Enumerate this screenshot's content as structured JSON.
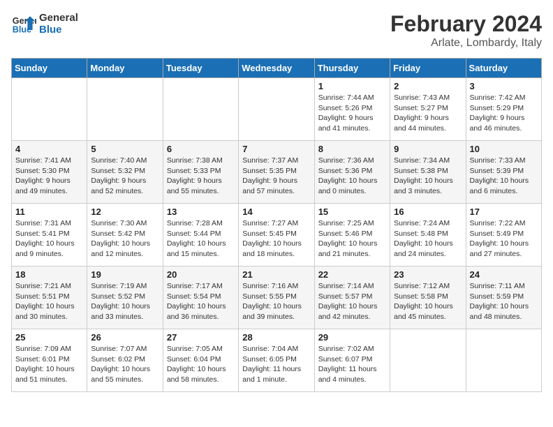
{
  "header": {
    "logo_line1": "General",
    "logo_line2": "Blue",
    "main_title": "February 2024",
    "subtitle": "Arlate, Lombardy, Italy"
  },
  "weekdays": [
    "Sunday",
    "Monday",
    "Tuesday",
    "Wednesday",
    "Thursday",
    "Friday",
    "Saturday"
  ],
  "weeks": [
    [
      {
        "day": "",
        "info": ""
      },
      {
        "day": "",
        "info": ""
      },
      {
        "day": "",
        "info": ""
      },
      {
        "day": "",
        "info": ""
      },
      {
        "day": "1",
        "info": "Sunrise: 7:44 AM\nSunset: 5:26 PM\nDaylight: 9 hours\nand 41 minutes."
      },
      {
        "day": "2",
        "info": "Sunrise: 7:43 AM\nSunset: 5:27 PM\nDaylight: 9 hours\nand 44 minutes."
      },
      {
        "day": "3",
        "info": "Sunrise: 7:42 AM\nSunset: 5:29 PM\nDaylight: 9 hours\nand 46 minutes."
      }
    ],
    [
      {
        "day": "4",
        "info": "Sunrise: 7:41 AM\nSunset: 5:30 PM\nDaylight: 9 hours\nand 49 minutes."
      },
      {
        "day": "5",
        "info": "Sunrise: 7:40 AM\nSunset: 5:32 PM\nDaylight: 9 hours\nand 52 minutes."
      },
      {
        "day": "6",
        "info": "Sunrise: 7:38 AM\nSunset: 5:33 PM\nDaylight: 9 hours\nand 55 minutes."
      },
      {
        "day": "7",
        "info": "Sunrise: 7:37 AM\nSunset: 5:35 PM\nDaylight: 9 hours\nand 57 minutes."
      },
      {
        "day": "8",
        "info": "Sunrise: 7:36 AM\nSunset: 5:36 PM\nDaylight: 10 hours\nand 0 minutes."
      },
      {
        "day": "9",
        "info": "Sunrise: 7:34 AM\nSunset: 5:38 PM\nDaylight: 10 hours\nand 3 minutes."
      },
      {
        "day": "10",
        "info": "Sunrise: 7:33 AM\nSunset: 5:39 PM\nDaylight: 10 hours\nand 6 minutes."
      }
    ],
    [
      {
        "day": "11",
        "info": "Sunrise: 7:31 AM\nSunset: 5:41 PM\nDaylight: 10 hours\nand 9 minutes."
      },
      {
        "day": "12",
        "info": "Sunrise: 7:30 AM\nSunset: 5:42 PM\nDaylight: 10 hours\nand 12 minutes."
      },
      {
        "day": "13",
        "info": "Sunrise: 7:28 AM\nSunset: 5:44 PM\nDaylight: 10 hours\nand 15 minutes."
      },
      {
        "day": "14",
        "info": "Sunrise: 7:27 AM\nSunset: 5:45 PM\nDaylight: 10 hours\nand 18 minutes."
      },
      {
        "day": "15",
        "info": "Sunrise: 7:25 AM\nSunset: 5:46 PM\nDaylight: 10 hours\nand 21 minutes."
      },
      {
        "day": "16",
        "info": "Sunrise: 7:24 AM\nSunset: 5:48 PM\nDaylight: 10 hours\nand 24 minutes."
      },
      {
        "day": "17",
        "info": "Sunrise: 7:22 AM\nSunset: 5:49 PM\nDaylight: 10 hours\nand 27 minutes."
      }
    ],
    [
      {
        "day": "18",
        "info": "Sunrise: 7:21 AM\nSunset: 5:51 PM\nDaylight: 10 hours\nand 30 minutes."
      },
      {
        "day": "19",
        "info": "Sunrise: 7:19 AM\nSunset: 5:52 PM\nDaylight: 10 hours\nand 33 minutes."
      },
      {
        "day": "20",
        "info": "Sunrise: 7:17 AM\nSunset: 5:54 PM\nDaylight: 10 hours\nand 36 minutes."
      },
      {
        "day": "21",
        "info": "Sunrise: 7:16 AM\nSunset: 5:55 PM\nDaylight: 10 hours\nand 39 minutes."
      },
      {
        "day": "22",
        "info": "Sunrise: 7:14 AM\nSunset: 5:57 PM\nDaylight: 10 hours\nand 42 minutes."
      },
      {
        "day": "23",
        "info": "Sunrise: 7:12 AM\nSunset: 5:58 PM\nDaylight: 10 hours\nand 45 minutes."
      },
      {
        "day": "24",
        "info": "Sunrise: 7:11 AM\nSunset: 5:59 PM\nDaylight: 10 hours\nand 48 minutes."
      }
    ],
    [
      {
        "day": "25",
        "info": "Sunrise: 7:09 AM\nSunset: 6:01 PM\nDaylight: 10 hours\nand 51 minutes."
      },
      {
        "day": "26",
        "info": "Sunrise: 7:07 AM\nSunset: 6:02 PM\nDaylight: 10 hours\nand 55 minutes."
      },
      {
        "day": "27",
        "info": "Sunrise: 7:05 AM\nSunset: 6:04 PM\nDaylight: 10 hours\nand 58 minutes."
      },
      {
        "day": "28",
        "info": "Sunrise: 7:04 AM\nSunset: 6:05 PM\nDaylight: 11 hours\nand 1 minute."
      },
      {
        "day": "29",
        "info": "Sunrise: 7:02 AM\nSunset: 6:07 PM\nDaylight: 11 hours\nand 4 minutes."
      },
      {
        "day": "",
        "info": ""
      },
      {
        "day": "",
        "info": ""
      }
    ]
  ]
}
